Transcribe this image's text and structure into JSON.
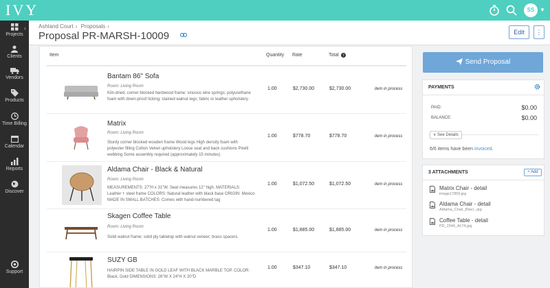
{
  "app": {
    "logo": "IVY",
    "avatar_initials": "SS"
  },
  "sidebar": {
    "items": [
      {
        "label": "Projects",
        "icon": "grid-icon"
      },
      {
        "label": "Clients",
        "icon": "users-icon"
      },
      {
        "label": "Vendors",
        "icon": "truck-icon"
      },
      {
        "label": "Products",
        "icon": "tag-icon"
      },
      {
        "label": "Time Billing",
        "icon": "clock-icon"
      },
      {
        "label": "Calendar",
        "icon": "calendar-icon"
      },
      {
        "label": "Reports",
        "icon": "bar-chart-icon"
      },
      {
        "label": "Discover",
        "icon": "globe-icon"
      },
      {
        "label": "Support",
        "icon": "support-icon"
      }
    ]
  },
  "header": {
    "breadcrumb": [
      "Ashland Court",
      "Proposals"
    ],
    "title": "Proposal PR-MARSH-10009",
    "edit_label": "Edit",
    "more_label": "⋮"
  },
  "table": {
    "columns": {
      "item": "Item",
      "quantity": "Quantity",
      "rate": "Rate",
      "total": "Total"
    },
    "rows": [
      {
        "name": "Bantam 86\" Sofa",
        "room": "Room: Living Room",
        "description": "Kiln-dried, corner blocked hardwood frame; sinuous wire springs; polyurethane foam with down-proof ticking; stained walnut legs; fabric or leather upholstery.",
        "quantity": "1.00",
        "rate": "$2,730.00",
        "total": "$2,730.00",
        "status": "item in process",
        "image": "sofa-image"
      },
      {
        "name": "Matrix",
        "room": "Room: Living Room",
        "description": "Sturdy corner blocked wooden frame Wood legs High density foam with polyester filling Cotton Velvet upholstery Loose seat and back cushions Pirelli webbing Some assembly required (approximately 15 minutes)",
        "quantity": "1.00",
        "rate": "$778.70",
        "total": "$778.70",
        "status": "item in process",
        "image": "pink-chair-image"
      },
      {
        "name": "Aldama Chair - Black & Natural",
        "room": "Room: Living Room",
        "description": "MEASUREMENTS: 27\"H x 31\"W. Seat measures 12\" high. MATERIALS: Leather + steel frame COLORS: Natural leather with black base ORIGIN: Mexico MADE IN SMALL BATCHES: Comes with hand-numbered tag",
        "quantity": "1.00",
        "rate": "$1,072.50",
        "total": "$1,072.50",
        "status": "item in process",
        "image": "round-chair-image"
      },
      {
        "name": "Skagen Coffee Table",
        "room": "Room: Living Room",
        "description": "Solid walnut frame; solid ply tabletop with walnut veneer; brass spacers.",
        "quantity": "1.00",
        "rate": "$1,885.00",
        "total": "$1,885.00",
        "status": "item in process",
        "image": "coffee-table-image"
      },
      {
        "name": "SUZY GB",
        "room": "",
        "description": "HAIRPIN SIDE TABLE IN GOLD LEAF WITH BLACK MARBLE TOP. COLOR: Black, Gold DIMENSIONS: 26\"W X 24\"H X 20\"D",
        "quantity": "1.00",
        "rate": "$347.10",
        "total": "$347.10",
        "status": "item in process",
        "image": "side-table-image"
      }
    ]
  },
  "send_button": "Send Proposal",
  "payments": {
    "title": "PAYMENTS",
    "paid_label": "PAID:",
    "paid_value": "$0.00",
    "balance_label": "BALANCE:",
    "balance_value": "$0.00",
    "see_details": "∨ See Details",
    "items_note_prefix": "6/6 items have been ",
    "items_note_link": "invoiced",
    "items_note_suffix": "."
  },
  "attachments": {
    "title": "3 ATTACHMENTS",
    "add_label": "+ Add",
    "items": [
      {
        "name": "Matrix Chair - detail",
        "file": "image17859.jpg"
      },
      {
        "name": "Aldama Chair - detail",
        "file": "Aldama_Chair_Blacl...jpg"
      },
      {
        "name": "Coffee Table - detail",
        "file": "PD_2344_ALT4.jpg"
      }
    ]
  },
  "colors": {
    "brand": "#4ecfc0",
    "sidebar": "#2c2c2c",
    "primary_button": "#6fa7d9",
    "link": "#4a90c9"
  }
}
